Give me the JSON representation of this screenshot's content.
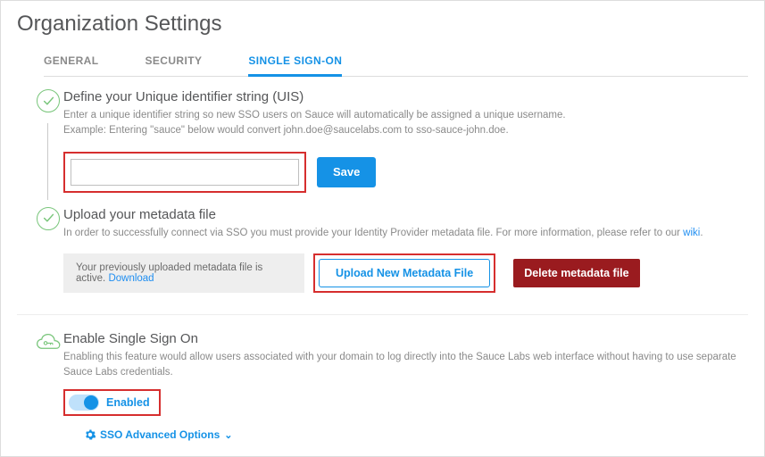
{
  "page": {
    "title": "Organization Settings"
  },
  "tabs": {
    "general": "GENERAL",
    "security": "SECURITY",
    "sso": "SINGLE SIGN-ON"
  },
  "uis": {
    "heading": "Define your Unique identifier string (UIS)",
    "help1": "Enter a unique identifier string so new SSO users on Sauce will automatically be assigned a unique username.",
    "help2": "Example: Entering \"sauce\" below would convert john.doe@saucelabs.com to sso-sauce-john.doe.",
    "value": "",
    "save": "Save"
  },
  "metadata": {
    "heading": "Upload your metadata file",
    "help_pre": "In order to successfully connect via SSO you must provide your Identity Provider metadata file. For more information, please refer to our ",
    "wiki_label": "wiki",
    "help_post": ".",
    "status_pre": "Your previously uploaded metadata file is active. ",
    "download_label": "Download",
    "upload_btn": "Upload New Metadata File",
    "delete_btn": "Delete metadata file"
  },
  "enable": {
    "heading": "Enable Single Sign On",
    "help": "Enabling this feature would allow users associated with your domain to log directly into the Sauce Labs web interface without having to use separate Sauce Labs credentials.",
    "toggle_label": "Enabled",
    "advanced": "SSO Advanced Options"
  }
}
